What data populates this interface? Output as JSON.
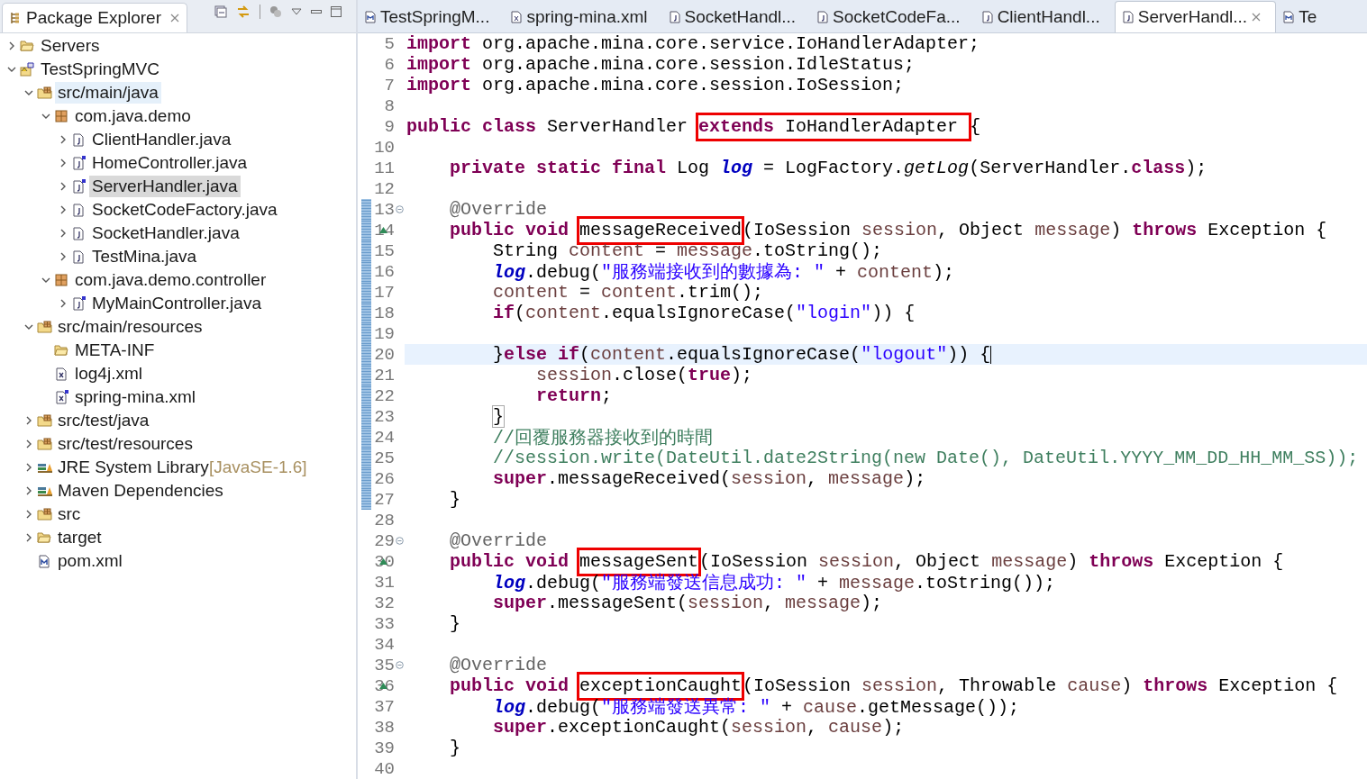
{
  "explorer": {
    "title": "Package Explorer",
    "tree": [
      {
        "label": "Servers",
        "kind": "folder",
        "expanded": false,
        "selected": false,
        "hovered": false
      },
      {
        "label": "TestSpringMVC",
        "kind": "project",
        "expanded": true,
        "selected": false,
        "hovered": false,
        "children": [
          {
            "label": "src/main/java",
            "kind": "source-folder",
            "expanded": true,
            "selected": false,
            "hovered": true,
            "children": [
              {
                "label": "com.java.demo",
                "kind": "package",
                "expanded": true,
                "selected": false,
                "hovered": false,
                "children": [
                  {
                    "label": "ClientHandler.java",
                    "kind": "java",
                    "expanded": false,
                    "selected": false,
                    "hovered": false
                  },
                  {
                    "label": "HomeController.java",
                    "kind": "spring-java",
                    "expanded": false,
                    "selected": false,
                    "hovered": false
                  },
                  {
                    "label": "ServerHandler.java",
                    "kind": "spring-java",
                    "expanded": false,
                    "selected": true,
                    "hovered": false
                  },
                  {
                    "label": "SocketCodeFactory.java",
                    "kind": "java",
                    "expanded": false,
                    "selected": false,
                    "hovered": false
                  },
                  {
                    "label": "SocketHandler.java",
                    "kind": "java",
                    "expanded": false,
                    "selected": false,
                    "hovered": false
                  },
                  {
                    "label": "TestMina.java",
                    "kind": "java",
                    "expanded": false,
                    "selected": false,
                    "hovered": false
                  }
                ]
              },
              {
                "label": "com.java.demo.controller",
                "kind": "package",
                "expanded": true,
                "selected": false,
                "hovered": false,
                "children": [
                  {
                    "label": "MyMainController.java",
                    "kind": "spring-java",
                    "expanded": false,
                    "selected": false,
                    "hovered": false
                  }
                ]
              }
            ]
          },
          {
            "label": "src/main/resources",
            "kind": "source-folder",
            "expanded": true,
            "selected": false,
            "hovered": false,
            "children": [
              {
                "label": "META-INF",
                "kind": "folder",
                "selected": false,
                "hovered": false
              },
              {
                "label": "log4j.xml",
                "kind": "xml",
                "selected": false,
                "hovered": false
              },
              {
                "label": "spring-mina.xml",
                "kind": "spring-xml",
                "selected": false,
                "hovered": false
              }
            ]
          },
          {
            "label": "src/test/java",
            "kind": "source-folder",
            "expanded": false,
            "selected": false,
            "hovered": false
          },
          {
            "label": "src/test/resources",
            "kind": "source-folder",
            "expanded": false,
            "selected": false,
            "hovered": false
          },
          {
            "label": "JRE System Library",
            "decoration": "[JavaSE-1.6]",
            "kind": "library",
            "expanded": false,
            "selected": false,
            "hovered": false
          },
          {
            "label": "Maven Dependencies",
            "kind": "library",
            "expanded": false,
            "selected": false,
            "hovered": false
          },
          {
            "label": "src",
            "kind": "spring-folder",
            "expanded": false,
            "selected": false,
            "hovered": false
          },
          {
            "label": "target",
            "kind": "folder",
            "expanded": false,
            "selected": false,
            "hovered": false
          },
          {
            "label": "pom.xml",
            "kind": "maven",
            "selected": false,
            "hovered": false
          }
        ]
      }
    ]
  },
  "editor_tabs": [
    {
      "label": "TestSpringM...",
      "kind": "maven",
      "selected": false
    },
    {
      "label": "spring-mina.xml",
      "kind": "xml",
      "selected": false
    },
    {
      "label": "SocketHandl...",
      "kind": "java",
      "selected": false
    },
    {
      "label": "SocketCodeFa...",
      "kind": "java",
      "selected": false
    },
    {
      "label": "ClientHandl...",
      "kind": "java",
      "selected": false
    },
    {
      "label": "ServerHandl...",
      "kind": "java",
      "selected": true
    },
    {
      "label": "Te",
      "kind": "maven",
      "selected": false
    }
  ],
  "code": [
    {
      "number": "5",
      "changed": false,
      "tokens": [
        {
          "kind": "keyword",
          "text": "import"
        },
        {
          "kind": "plain",
          "text": " org.apache.mina.core.service.IoHandlerAdapter;"
        }
      ]
    },
    {
      "number": "6",
      "changed": false,
      "tokens": [
        {
          "kind": "keyword",
          "text": "import"
        },
        {
          "kind": "plain",
          "text": " org.apache.mina.core.session.IdleStatus;"
        }
      ]
    },
    {
      "number": "7",
      "changed": false,
      "tokens": [
        {
          "kind": "keyword",
          "text": "import"
        },
        {
          "kind": "plain",
          "text": " org.apache.mina.core.session.IoSession;"
        }
      ]
    },
    {
      "number": "8",
      "changed": false
    },
    {
      "number": "9",
      "changed": false,
      "tokens": [
        {
          "kind": "keyword",
          "text": "public class"
        },
        {
          "kind": "plain",
          "text": " ServerHandler "
        },
        {
          "kind": "box",
          "tokens": [
            {
              "kind": "keyword",
              "text": "extends"
            },
            {
              "kind": "plain",
              "text": " IoHandlerAdapter "
            }
          ]
        },
        {
          "kind": "plain",
          "text": "{"
        }
      ]
    },
    {
      "number": "10",
      "changed": false
    },
    {
      "number": "11",
      "changed": false,
      "tokens": [
        {
          "kind": "keyword",
          "text": "    private static final"
        },
        {
          "kind": "plain",
          "text": " Log "
        },
        {
          "kind": "static-field",
          "text": "log"
        },
        {
          "kind": "plain",
          "text": " = LogFactory."
        },
        {
          "kind": "static-method",
          "text": "getLog"
        },
        {
          "kind": "plain",
          "text": "(ServerHandler."
        },
        {
          "kind": "keyword",
          "text": "class"
        },
        {
          "kind": "plain",
          "text": ");"
        }
      ]
    },
    {
      "number": "12",
      "changed": false
    },
    {
      "number": "13",
      "foldable": true,
      "changed": true,
      "tokens": [
        {
          "kind": "annotation",
          "text": "    @Override"
        }
      ]
    },
    {
      "number": "14",
      "overrides": true,
      "changed": true,
      "tokens": [
        {
          "kind": "keyword",
          "text": "    public void "
        },
        {
          "kind": "box",
          "tokens": [
            {
              "kind": "plain",
              "text": "messageReceived"
            }
          ]
        },
        {
          "kind": "plain",
          "text": "(IoSession "
        },
        {
          "kind": "variable",
          "text": "session"
        },
        {
          "kind": "plain",
          "text": ", Object "
        },
        {
          "kind": "variable",
          "text": "message"
        },
        {
          "kind": "plain",
          "text": ") "
        },
        {
          "kind": "keyword",
          "text": "throws"
        },
        {
          "kind": "plain",
          "text": " Exception {"
        }
      ]
    },
    {
      "number": "15",
      "changed": true,
      "tokens": [
        {
          "kind": "plain",
          "text": "        String "
        },
        {
          "kind": "variable",
          "text": "content"
        },
        {
          "kind": "plain",
          "text": " = "
        },
        {
          "kind": "variable",
          "text": "message"
        },
        {
          "kind": "plain",
          "text": ".toString();"
        }
      ]
    },
    {
      "number": "16",
      "changed": true,
      "tokens": [
        {
          "kind": "static-field",
          "text": "        log"
        },
        {
          "kind": "plain",
          "text": ".debug("
        },
        {
          "kind": "string",
          "text": "\"服務端接收到的數據為: \""
        },
        {
          "kind": "plain",
          "text": " + "
        },
        {
          "kind": "variable",
          "text": "content"
        },
        {
          "kind": "plain",
          "text": ");"
        }
      ]
    },
    {
      "number": "17",
      "changed": true,
      "tokens": [
        {
          "kind": "variable",
          "text": "        content"
        },
        {
          "kind": "plain",
          "text": " = "
        },
        {
          "kind": "variable",
          "text": "content"
        },
        {
          "kind": "plain",
          "text": ".trim();"
        }
      ]
    },
    {
      "number": "18",
      "changed": true,
      "tokens": [
        {
          "kind": "keyword",
          "text": "        if"
        },
        {
          "kind": "plain",
          "text": "("
        },
        {
          "kind": "variable",
          "text": "content"
        },
        {
          "kind": "plain",
          "text": ".equalsIgnoreCase("
        },
        {
          "kind": "string",
          "text": "\"login\""
        },
        {
          "kind": "plain",
          "text": ")) {"
        }
      ]
    },
    {
      "number": "19",
      "changed": true
    },
    {
      "number": "20",
      "changed": true,
      "current": true,
      "tokens": [
        {
          "kind": "plain",
          "text": "        }"
        },
        {
          "kind": "keyword",
          "text": "else if"
        },
        {
          "kind": "plain",
          "text": "("
        },
        {
          "kind": "variable",
          "text": "content"
        },
        {
          "kind": "plain",
          "text": ".equalsIgnoreCase("
        },
        {
          "kind": "string",
          "text": "\"logout\""
        },
        {
          "kind": "plain",
          "text": ")) {"
        }
      ]
    },
    {
      "number": "21",
      "changed": true,
      "tokens": [
        {
          "kind": "variable",
          "text": "            session"
        },
        {
          "kind": "plain",
          "text": ".close("
        },
        {
          "kind": "keyword",
          "text": "true"
        },
        {
          "kind": "plain",
          "text": ");"
        }
      ]
    },
    {
      "number": "22",
      "changed": true,
      "tokens": [
        {
          "kind": "keyword",
          "text": "            return"
        },
        {
          "kind": "plain",
          "text": ";"
        }
      ]
    },
    {
      "number": "23",
      "changed": true,
      "tokens": [
        {
          "kind": "bracket",
          "text": "}"
        }
      ]
    },
    {
      "number": "24",
      "changed": true,
      "tokens": [
        {
          "kind": "comment",
          "text": "        //回覆服務器接收到的時間"
        }
      ]
    },
    {
      "number": "25",
      "changed": true,
      "tokens": [
        {
          "kind": "comment",
          "text": "        //session.write(DateUtil.date2String(new Date(), DateUtil.YYYY_MM_DD_HH_MM_SS));"
        }
      ]
    },
    {
      "number": "26",
      "changed": true,
      "tokens": [
        {
          "kind": "keyword",
          "text": "        super"
        },
        {
          "kind": "plain",
          "text": ".messageReceived("
        },
        {
          "kind": "variable",
          "text": "session"
        },
        {
          "kind": "plain",
          "text": ", "
        },
        {
          "kind": "variable",
          "text": "message"
        },
        {
          "kind": "plain",
          "text": ");"
        }
      ]
    },
    {
      "number": "27",
      "changed": true,
      "tokens": [
        {
          "kind": "plain",
          "text": "    }"
        }
      ]
    },
    {
      "number": "28",
      "changed": false
    },
    {
      "number": "29",
      "foldable": true,
      "changed": false,
      "tokens": [
        {
          "kind": "annotation",
          "text": "    @Override"
        }
      ]
    },
    {
      "number": "30",
      "overrides": true,
      "changed": false,
      "tokens": [
        {
          "kind": "keyword",
          "text": "    public void "
        },
        {
          "kind": "box",
          "tokens": [
            {
              "kind": "plain",
              "text": "messageSent"
            }
          ]
        },
        {
          "kind": "plain",
          "text": "(IoSession "
        },
        {
          "kind": "variable",
          "text": "session"
        },
        {
          "kind": "plain",
          "text": ", Object "
        },
        {
          "kind": "variable",
          "text": "message"
        },
        {
          "kind": "plain",
          "text": ") "
        },
        {
          "kind": "keyword",
          "text": "throws"
        },
        {
          "kind": "plain",
          "text": " Exception {"
        }
      ]
    },
    {
      "number": "31",
      "changed": false,
      "tokens": [
        {
          "kind": "static-field",
          "text": "        log"
        },
        {
          "kind": "plain",
          "text": ".debug("
        },
        {
          "kind": "string",
          "text": "\"服務端發送信息成功: \""
        },
        {
          "kind": "plain",
          "text": " + "
        },
        {
          "kind": "variable",
          "text": "message"
        },
        {
          "kind": "plain",
          "text": ".toString());"
        }
      ]
    },
    {
      "number": "32",
      "changed": false,
      "tokens": [
        {
          "kind": "keyword",
          "text": "        super"
        },
        {
          "kind": "plain",
          "text": ".messageSent("
        },
        {
          "kind": "variable",
          "text": "session"
        },
        {
          "kind": "plain",
          "text": ", "
        },
        {
          "kind": "variable",
          "text": "message"
        },
        {
          "kind": "plain",
          "text": ");"
        }
      ]
    },
    {
      "number": "33",
      "changed": false,
      "tokens": [
        {
          "kind": "plain",
          "text": "    }"
        }
      ]
    },
    {
      "number": "34",
      "changed": false
    },
    {
      "number": "35",
      "foldable": true,
      "changed": false,
      "tokens": [
        {
          "kind": "annotation",
          "text": "    @Override"
        }
      ]
    },
    {
      "number": "36",
      "overrides": true,
      "changed": false,
      "tokens": [
        {
          "kind": "keyword",
          "text": "    public void "
        },
        {
          "kind": "box",
          "tokens": [
            {
              "kind": "plain",
              "text": "exceptionCaught"
            }
          ]
        },
        {
          "kind": "plain",
          "text": "(IoSession "
        },
        {
          "kind": "variable",
          "text": "session"
        },
        {
          "kind": "plain",
          "text": ", Throwable "
        },
        {
          "kind": "variable",
          "text": "cause"
        },
        {
          "kind": "plain",
          "text": ") "
        },
        {
          "kind": "keyword",
          "text": "throws"
        },
        {
          "kind": "plain",
          "text": " Exception {"
        }
      ]
    },
    {
      "number": "37",
      "changed": false,
      "tokens": [
        {
          "kind": "static-field",
          "text": "        log"
        },
        {
          "kind": "plain",
          "text": ".debug("
        },
        {
          "kind": "string",
          "text": "\"服務端發送異常: \""
        },
        {
          "kind": "plain",
          "text": " + "
        },
        {
          "kind": "variable",
          "text": "cause"
        },
        {
          "kind": "plain",
          "text": ".getMessage());"
        }
      ]
    },
    {
      "number": "38",
      "changed": false,
      "tokens": [
        {
          "kind": "keyword",
          "text": "        super"
        },
        {
          "kind": "plain",
          "text": ".exceptionCaught("
        },
        {
          "kind": "variable",
          "text": "session"
        },
        {
          "kind": "plain",
          "text": ", "
        },
        {
          "kind": "variable",
          "text": "cause"
        },
        {
          "kind": "plain",
          "text": ");"
        }
      ]
    },
    {
      "number": "39",
      "changed": false,
      "tokens": [
        {
          "kind": "plain",
          "text": "    }"
        }
      ]
    },
    {
      "number": "40",
      "changed": false
    }
  ]
}
